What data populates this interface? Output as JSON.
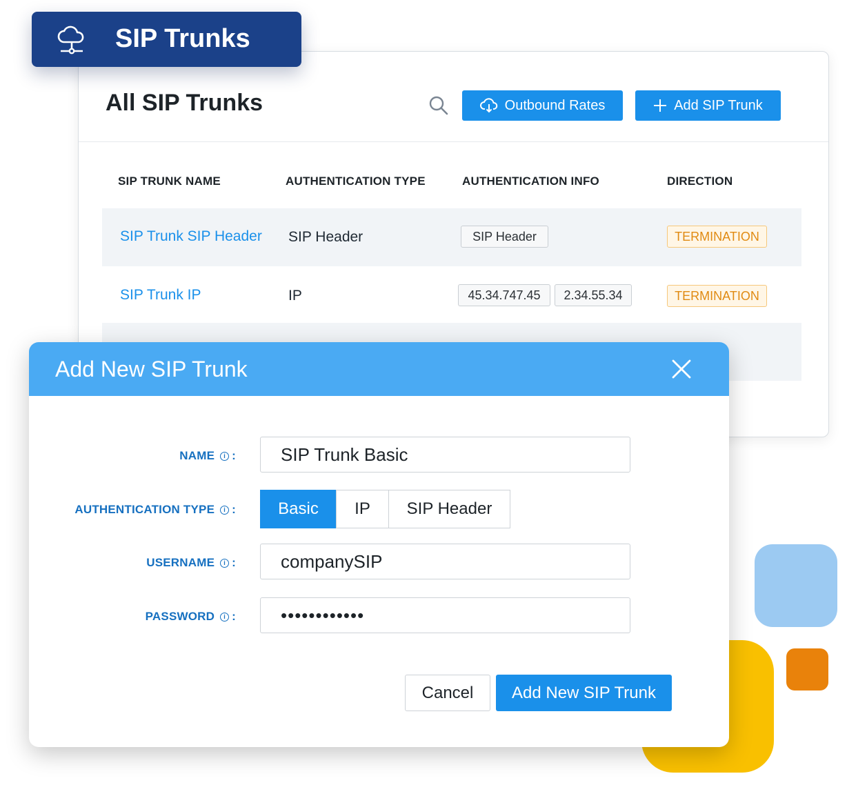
{
  "badge": {
    "title": "SIP Trunks"
  },
  "list": {
    "title": "All SIP Trunks",
    "outbound_label": "Outbound Rates",
    "add_label": "Add SIP Trunk",
    "columns": [
      "SIP TRUNK NAME",
      "AUTHENTICATION TYPE",
      "AUTHENTICATION INFO",
      "DIRECTION"
    ],
    "rows": [
      {
        "name": "SIP Trunk SIP Header",
        "auth_type": "SIP Header",
        "auth_info": [
          "SIP Header"
        ],
        "direction": "TERMINATION"
      },
      {
        "name": "SIP Trunk IP",
        "auth_type": "IP",
        "auth_info": [
          "45.34.747.45",
          "2.34.55.34"
        ],
        "direction": "TERMINATION"
      }
    ]
  },
  "modal": {
    "title": "Add New SIP Trunk",
    "fields": {
      "name": {
        "label": "NAME",
        "value": "SIP Trunk Basic"
      },
      "auth_type": {
        "label": "AUTHENTICATION TYPE",
        "options": [
          "Basic",
          "IP",
          "SIP Header"
        ],
        "selected": "Basic"
      },
      "username": {
        "label": "USERNAME",
        "value": "companySIP"
      },
      "password": {
        "label": "PASSWORD",
        "value": "••••••••••••"
      }
    },
    "cancel_label": "Cancel",
    "submit_label": "Add New SIP Trunk"
  },
  "icons": {
    "badge": "cloud-network-icon",
    "search": "search-icon",
    "outbound": "cloud-download-icon",
    "add": "plus-icon",
    "close": "close-icon",
    "info": "info-icon"
  },
  "colors": {
    "brand_navy": "#1b4189",
    "primary": "#1a90ea",
    "modal_header": "#4aaaf3",
    "termination_text": "#e08a12",
    "deco_yellow": "#f9c000",
    "deco_blue": "#9ccaf2",
    "deco_orange": "#e9820b"
  }
}
